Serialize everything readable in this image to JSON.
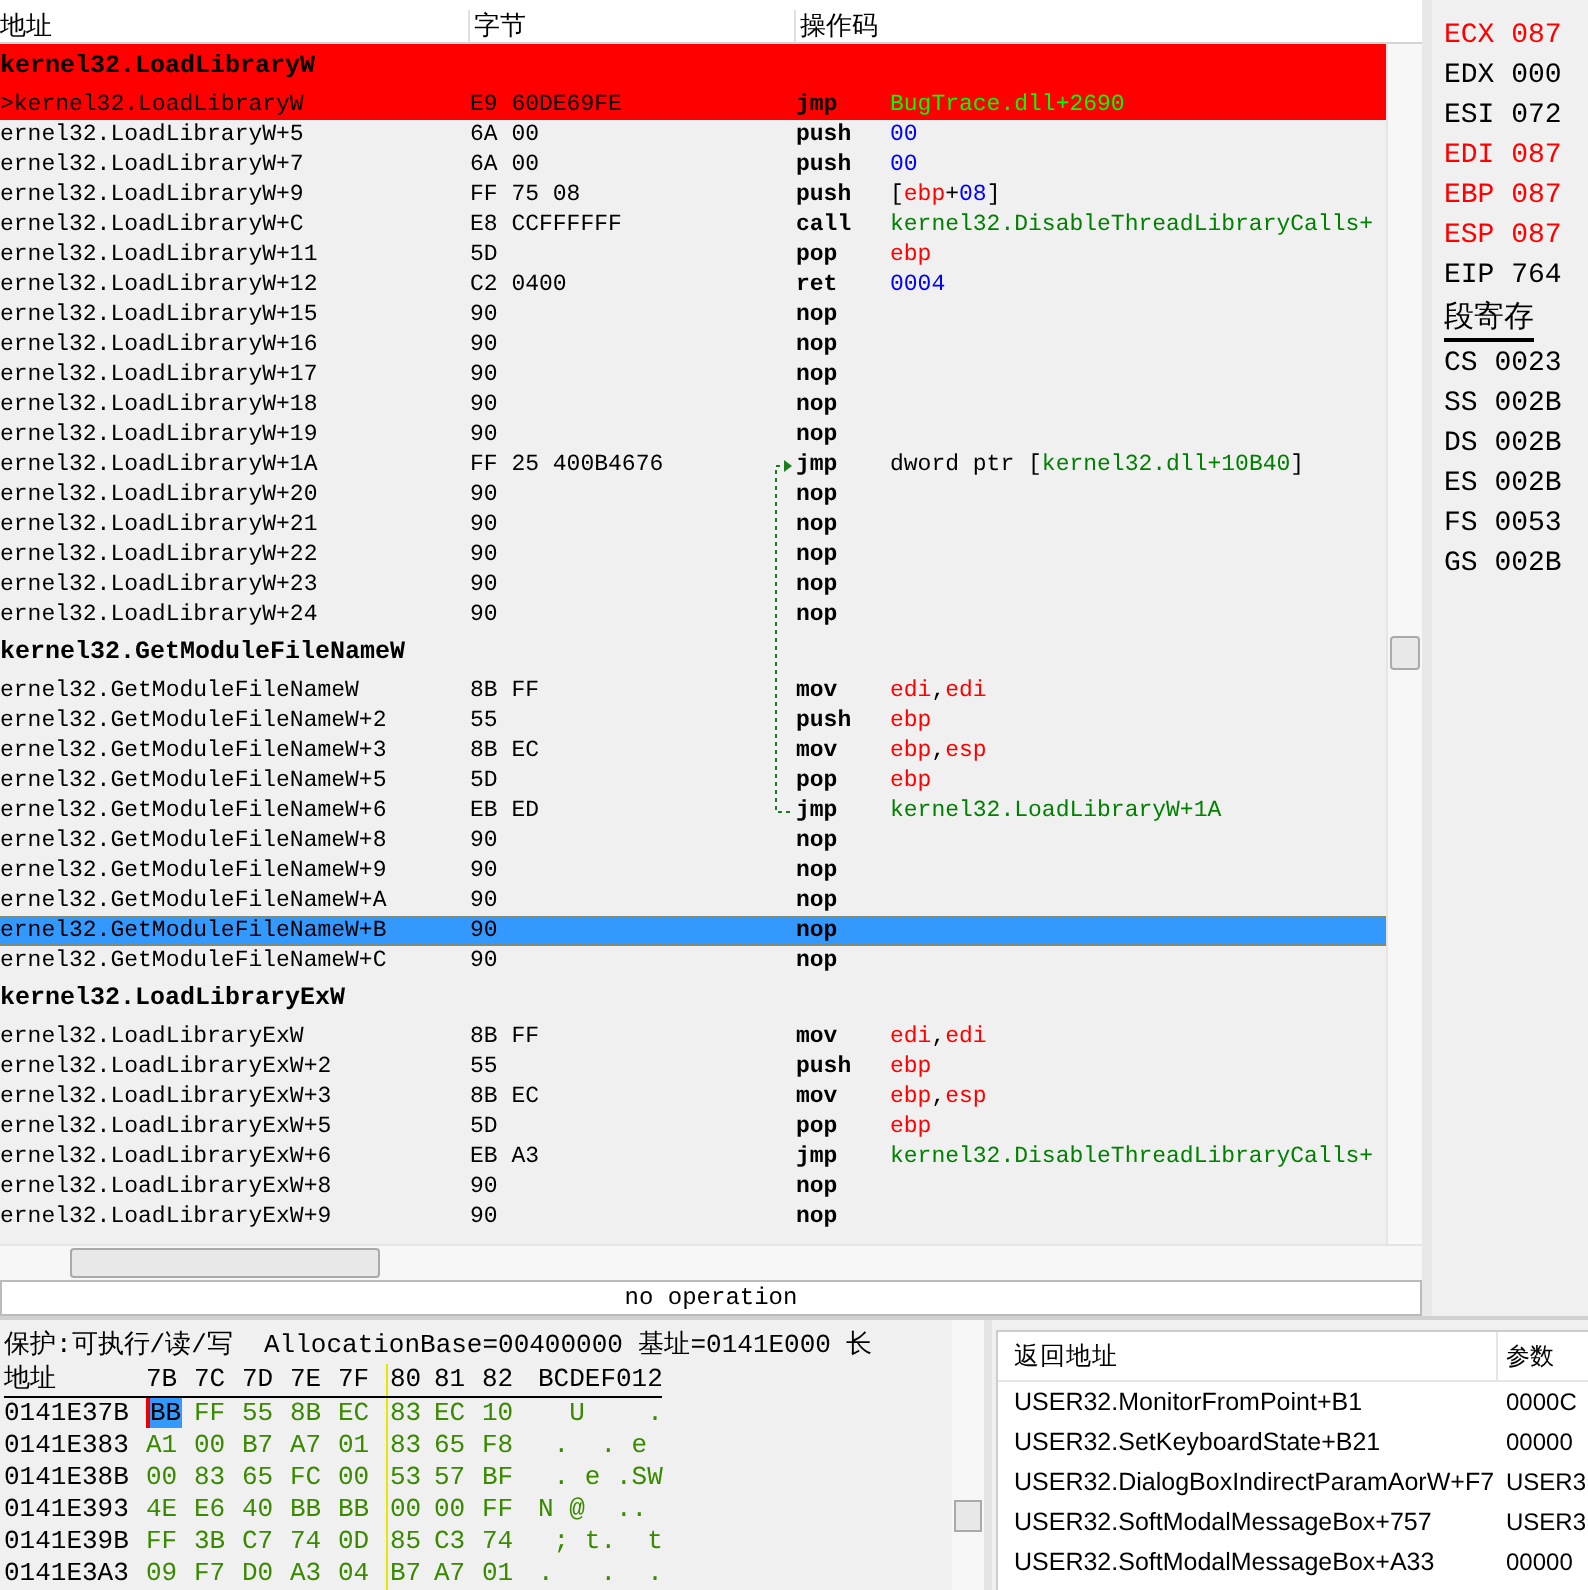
{
  "disassembly": {
    "columns": [
      "地址",
      "字节",
      "操作码"
    ],
    "rows": [
      {
        "kind": "label",
        "text": "kernel32.LoadLibraryW",
        "breakpoint": true
      },
      {
        "kind": "instr",
        "address": ">kernel32.LoadLibraryW",
        "bytes": "E9 60DE69FE",
        "mnemonic": "jmp",
        "operand": [
          {
            "kind": "symbol",
            "text": "BugTrace.dll+2690"
          }
        ],
        "breakpoint": true,
        "selected": false
      },
      {
        "kind": "instr",
        "address": "ernel32.LoadLibraryW+5",
        "bytes": "6A 00",
        "mnemonic": "push",
        "operand": [
          {
            "kind": "number",
            "text": "00"
          }
        ],
        "breakpoint": false,
        "selected": false
      },
      {
        "kind": "instr",
        "address": "ernel32.LoadLibraryW+7",
        "bytes": "6A 00",
        "mnemonic": "push",
        "operand": [
          {
            "kind": "number",
            "text": "00"
          }
        ],
        "breakpoint": false,
        "selected": false
      },
      {
        "kind": "instr",
        "address": "ernel32.LoadLibraryW+9",
        "bytes": "FF 75 08",
        "mnemonic": "push",
        "operand": [
          {
            "kind": "plain",
            "text": "["
          },
          {
            "kind": "register",
            "text": "ebp"
          },
          {
            "kind": "plain",
            "text": "+"
          },
          {
            "kind": "number",
            "text": "08"
          },
          {
            "kind": "plain",
            "text": "]"
          }
        ],
        "breakpoint": false,
        "selected": false
      },
      {
        "kind": "instr",
        "address": "ernel32.LoadLibraryW+C",
        "bytes": "E8 CCFFFFFF",
        "mnemonic": "call",
        "operand": [
          {
            "kind": "symbol",
            "text": "kernel32.DisableThreadLibraryCalls+"
          }
        ],
        "breakpoint": false,
        "selected": false
      },
      {
        "kind": "instr",
        "address": "ernel32.LoadLibraryW+11",
        "bytes": "5D",
        "mnemonic": "pop",
        "operand": [
          {
            "kind": "register",
            "text": "ebp"
          }
        ],
        "breakpoint": false,
        "selected": false
      },
      {
        "kind": "instr",
        "address": "ernel32.LoadLibraryW+12",
        "bytes": "C2 0400",
        "mnemonic": "ret",
        "operand": [
          {
            "kind": "number",
            "text": "0004"
          }
        ],
        "breakpoint": false,
        "selected": false
      },
      {
        "kind": "instr",
        "address": "ernel32.LoadLibraryW+15",
        "bytes": "90",
        "mnemonic": "nop",
        "operand": [],
        "breakpoint": false,
        "selected": false
      },
      {
        "kind": "instr",
        "address": "ernel32.LoadLibraryW+16",
        "bytes": "90",
        "mnemonic": "nop",
        "operand": [],
        "breakpoint": false,
        "selected": false
      },
      {
        "kind": "instr",
        "address": "ernel32.LoadLibraryW+17",
        "bytes": "90",
        "mnemonic": "nop",
        "operand": [],
        "breakpoint": false,
        "selected": false
      },
      {
        "kind": "instr",
        "address": "ernel32.LoadLibraryW+18",
        "bytes": "90",
        "mnemonic": "nop",
        "operand": [],
        "breakpoint": false,
        "selected": false
      },
      {
        "kind": "instr",
        "address": "ernel32.LoadLibraryW+19",
        "bytes": "90",
        "mnemonic": "nop",
        "operand": [],
        "breakpoint": false,
        "selected": false
      },
      {
        "kind": "instr",
        "address": "ernel32.LoadLibraryW+1A",
        "bytes": "FF 25 400B4676",
        "mnemonic": "jmp",
        "operand": [
          {
            "kind": "plain",
            "text": "dword ptr ["
          },
          {
            "kind": "symbol",
            "text": "kernel32.dll+10B40"
          },
          {
            "kind": "plain",
            "text": "]"
          }
        ],
        "breakpoint": false,
        "selected": false,
        "jump_target": true
      },
      {
        "kind": "instr",
        "address": "ernel32.LoadLibraryW+20",
        "bytes": "90",
        "mnemonic": "nop",
        "operand": [],
        "breakpoint": false,
        "selected": false
      },
      {
        "kind": "instr",
        "address": "ernel32.LoadLibraryW+21",
        "bytes": "90",
        "mnemonic": "nop",
        "operand": [],
        "breakpoint": false,
        "selected": false
      },
      {
        "kind": "instr",
        "address": "ernel32.LoadLibraryW+22",
        "bytes": "90",
        "mnemonic": "nop",
        "operand": [],
        "breakpoint": false,
        "selected": false
      },
      {
        "kind": "instr",
        "address": "ernel32.LoadLibraryW+23",
        "bytes": "90",
        "mnemonic": "nop",
        "operand": [],
        "breakpoint": false,
        "selected": false
      },
      {
        "kind": "instr",
        "address": "ernel32.LoadLibraryW+24",
        "bytes": "90",
        "mnemonic": "nop",
        "operand": [],
        "breakpoint": false,
        "selected": false
      },
      {
        "kind": "label",
        "text": "kernel32.GetModuleFileNameW",
        "breakpoint": false
      },
      {
        "kind": "instr",
        "address": "ernel32.GetModuleFileNameW",
        "bytes": "8B FF",
        "mnemonic": "mov",
        "operand": [
          {
            "kind": "register",
            "text": "edi"
          },
          {
            "kind": "plain",
            "text": ","
          },
          {
            "kind": "register",
            "text": "edi"
          }
        ],
        "breakpoint": false,
        "selected": false
      },
      {
        "kind": "instr",
        "address": "ernel32.GetModuleFileNameW+2",
        "bytes": "55",
        "mnemonic": "push",
        "operand": [
          {
            "kind": "register",
            "text": "ebp"
          }
        ],
        "breakpoint": false,
        "selected": false
      },
      {
        "kind": "instr",
        "address": "ernel32.GetModuleFileNameW+3",
        "bytes": "8B EC",
        "mnemonic": "mov",
        "operand": [
          {
            "kind": "register",
            "text": "ebp"
          },
          {
            "kind": "plain",
            "text": ","
          },
          {
            "kind": "register",
            "text": "esp"
          }
        ],
        "breakpoint": false,
        "selected": false
      },
      {
        "kind": "instr",
        "address": "ernel32.GetModuleFileNameW+5",
        "bytes": "5D",
        "mnemonic": "pop",
        "operand": [
          {
            "kind": "register",
            "text": "ebp"
          }
        ],
        "breakpoint": false,
        "selected": false
      },
      {
        "kind": "instr",
        "address": "ernel32.GetModuleFileNameW+6",
        "bytes": "EB ED",
        "mnemonic": "jmp",
        "operand": [
          {
            "kind": "symbol",
            "text": "kernel32.LoadLibraryW+1A"
          }
        ],
        "breakpoint": false,
        "selected": false,
        "jump_source": true
      },
      {
        "kind": "instr",
        "address": "ernel32.GetModuleFileNameW+8",
        "bytes": "90",
        "mnemonic": "nop",
        "operand": [],
        "breakpoint": false,
        "selected": false
      },
      {
        "kind": "instr",
        "address": "ernel32.GetModuleFileNameW+9",
        "bytes": "90",
        "mnemonic": "nop",
        "operand": [],
        "breakpoint": false,
        "selected": false
      },
      {
        "kind": "instr",
        "address": "ernel32.GetModuleFileNameW+A",
        "bytes": "90",
        "mnemonic": "nop",
        "operand": [],
        "breakpoint": false,
        "selected": false
      },
      {
        "kind": "instr",
        "address": "ernel32.GetModuleFileNameW+B",
        "bytes": "90",
        "mnemonic": "nop",
        "operand": [],
        "breakpoint": false,
        "selected": true
      },
      {
        "kind": "instr",
        "address": "ernel32.GetModuleFileNameW+C",
        "bytes": "90",
        "mnemonic": "nop",
        "operand": [],
        "breakpoint": false,
        "selected": false
      },
      {
        "kind": "label",
        "text": "kernel32.LoadLibraryExW",
        "breakpoint": false
      },
      {
        "kind": "instr",
        "address": "ernel32.LoadLibraryExW",
        "bytes": "8B FF",
        "mnemonic": "mov",
        "operand": [
          {
            "kind": "register",
            "text": "edi"
          },
          {
            "kind": "plain",
            "text": ","
          },
          {
            "kind": "register",
            "text": "edi"
          }
        ],
        "breakpoint": false,
        "selected": false
      },
      {
        "kind": "instr",
        "address": "ernel32.LoadLibraryExW+2",
        "bytes": "55",
        "mnemonic": "push",
        "operand": [
          {
            "kind": "register",
            "text": "ebp"
          }
        ],
        "breakpoint": false,
        "selected": false
      },
      {
        "kind": "instr",
        "address": "ernel32.LoadLibraryExW+3",
        "bytes": "8B EC",
        "mnemonic": "mov",
        "operand": [
          {
            "kind": "register",
            "text": "ebp"
          },
          {
            "kind": "plain",
            "text": ","
          },
          {
            "kind": "register",
            "text": "esp"
          }
        ],
        "breakpoint": false,
        "selected": false
      },
      {
        "kind": "instr",
        "address": "ernel32.LoadLibraryExW+5",
        "bytes": "5D",
        "mnemonic": "pop",
        "operand": [
          {
            "kind": "register",
            "text": "ebp"
          }
        ],
        "breakpoint": false,
        "selected": false
      },
      {
        "kind": "instr",
        "address": "ernel32.LoadLibraryExW+6",
        "bytes": "EB A3",
        "mnemonic": "jmp",
        "operand": [
          {
            "kind": "symbol",
            "text": "kernel32.DisableThreadLibraryCalls+"
          }
        ],
        "breakpoint": false,
        "selected": false
      },
      {
        "kind": "instr",
        "address": "ernel32.LoadLibraryExW+8",
        "bytes": "90",
        "mnemonic": "nop",
        "operand": [],
        "breakpoint": false,
        "selected": false
      },
      {
        "kind": "instr",
        "address": "ernel32.LoadLibraryExW+9",
        "bytes": "90",
        "mnemonic": "nop",
        "operand": [],
        "breakpoint": false,
        "selected": false
      }
    ]
  },
  "status_text": "no operation",
  "registers": [
    {
      "name": "ECX",
      "value": "087",
      "changed": true
    },
    {
      "name": "EDX",
      "value": "000",
      "changed": false
    },
    {
      "name": "ESI",
      "value": "072",
      "changed": false
    },
    {
      "name": "EDI",
      "value": "087",
      "changed": true
    },
    {
      "name": "EBP",
      "value": "087",
      "changed": true
    },
    {
      "name": "ESP",
      "value": "087",
      "changed": true
    },
    {
      "name": "EIP",
      "value": "764",
      "changed": false
    }
  ],
  "segment_title": "段寄存",
  "segments": [
    {
      "name": "CS",
      "value": "0023"
    },
    {
      "name": "SS",
      "value": "002B"
    },
    {
      "name": "DS",
      "value": "002B"
    },
    {
      "name": "ES",
      "value": "002B"
    },
    {
      "name": "FS",
      "value": "0053"
    },
    {
      "name": "GS",
      "value": "002B"
    }
  ],
  "hex_view": {
    "info": "保护:可执行/读/写  AllocationBase=00400000 基址=0141E000 长",
    "address_heading": "地址",
    "byte_headings": [
      "7B",
      "7C",
      "7D",
      "7E",
      "7F",
      "80",
      "81",
      "82"
    ],
    "ascii_heading": "BCDEF012",
    "rows": [
      {
        "address": "0141E37B",
        "bytes": [
          {
            "text": "BB",
            "selected": true
          },
          {
            "text": "FF",
            "selected": false
          },
          {
            "text": "55",
            "selected": false
          },
          {
            "text": "8B",
            "selected": false
          },
          {
            "text": "EC",
            "selected": false
          },
          {
            "text": "83",
            "selected": false
          },
          {
            "text": "EC",
            "selected": false
          },
          {
            "text": "10",
            "selected": false
          }
        ],
        "ascii": "  U    ."
      },
      {
        "address": "0141E383",
        "bytes": [
          {
            "text": "A1",
            "selected": false
          },
          {
            "text": "00",
            "selected": false
          },
          {
            "text": "B7",
            "selected": false
          },
          {
            "text": "A7",
            "selected": false
          },
          {
            "text": "01",
            "selected": false
          },
          {
            "text": "83",
            "selected": false
          },
          {
            "text": "65",
            "selected": false
          },
          {
            "text": "F8",
            "selected": false
          }
        ],
        "ascii": " .  . e"
      },
      {
        "address": "0141E38B",
        "bytes": [
          {
            "text": "00",
            "selected": false
          },
          {
            "text": "83",
            "selected": false
          },
          {
            "text": "65",
            "selected": false
          },
          {
            "text": "FC",
            "selected": false
          },
          {
            "text": "00",
            "selected": false
          },
          {
            "text": "53",
            "selected": false
          },
          {
            "text": "57",
            "selected": false
          },
          {
            "text": "BF",
            "selected": false
          }
        ],
        "ascii": " . e .SW"
      },
      {
        "address": "0141E393",
        "bytes": [
          {
            "text": "4E",
            "selected": false
          },
          {
            "text": "E6",
            "selected": false
          },
          {
            "text": "40",
            "selected": false
          },
          {
            "text": "BB",
            "selected": false
          },
          {
            "text": "BB",
            "selected": false
          },
          {
            "text": "00",
            "selected": false
          },
          {
            "text": "00",
            "selected": false
          },
          {
            "text": "FF",
            "selected": false
          }
        ],
        "ascii": "N @  .."
      },
      {
        "address": "0141E39B",
        "bytes": [
          {
            "text": "FF",
            "selected": false
          },
          {
            "text": "3B",
            "selected": false
          },
          {
            "text": "C7",
            "selected": false
          },
          {
            "text": "74",
            "selected": false
          },
          {
            "text": "0D",
            "selected": false
          },
          {
            "text": "85",
            "selected": false
          },
          {
            "text": "C3",
            "selected": false
          },
          {
            "text": "74",
            "selected": false
          }
        ],
        "ascii": " ; t.  t"
      },
      {
        "address": "0141E3A3",
        "bytes": [
          {
            "text": "09",
            "selected": false
          },
          {
            "text": "F7",
            "selected": false
          },
          {
            "text": "D0",
            "selected": false
          },
          {
            "text": "A3",
            "selected": false
          },
          {
            "text": "04",
            "selected": false
          },
          {
            "text": "B7",
            "selected": false
          },
          {
            "text": "A7",
            "selected": false
          },
          {
            "text": "01",
            "selected": false
          }
        ],
        "ascii": ".   .  ."
      }
    ]
  },
  "call_stack": {
    "columns": [
      "返回地址",
      "参数"
    ],
    "rows": [
      {
        "return_address": "USER32.MonitorFromPoint+B1",
        "parameters": "0000C"
      },
      {
        "return_address": "USER32.SetKeyboardState+B21",
        "parameters": "00000"
      },
      {
        "return_address": "USER32.DialogBoxIndirectParamAorW+F7",
        "parameters": "USER3"
      },
      {
        "return_address": "USER32.SoftModalMessageBox+757",
        "parameters": "USER3"
      },
      {
        "return_address": "USER32.SoftModalMessageBox+A33",
        "parameters": "00000"
      }
    ]
  }
}
